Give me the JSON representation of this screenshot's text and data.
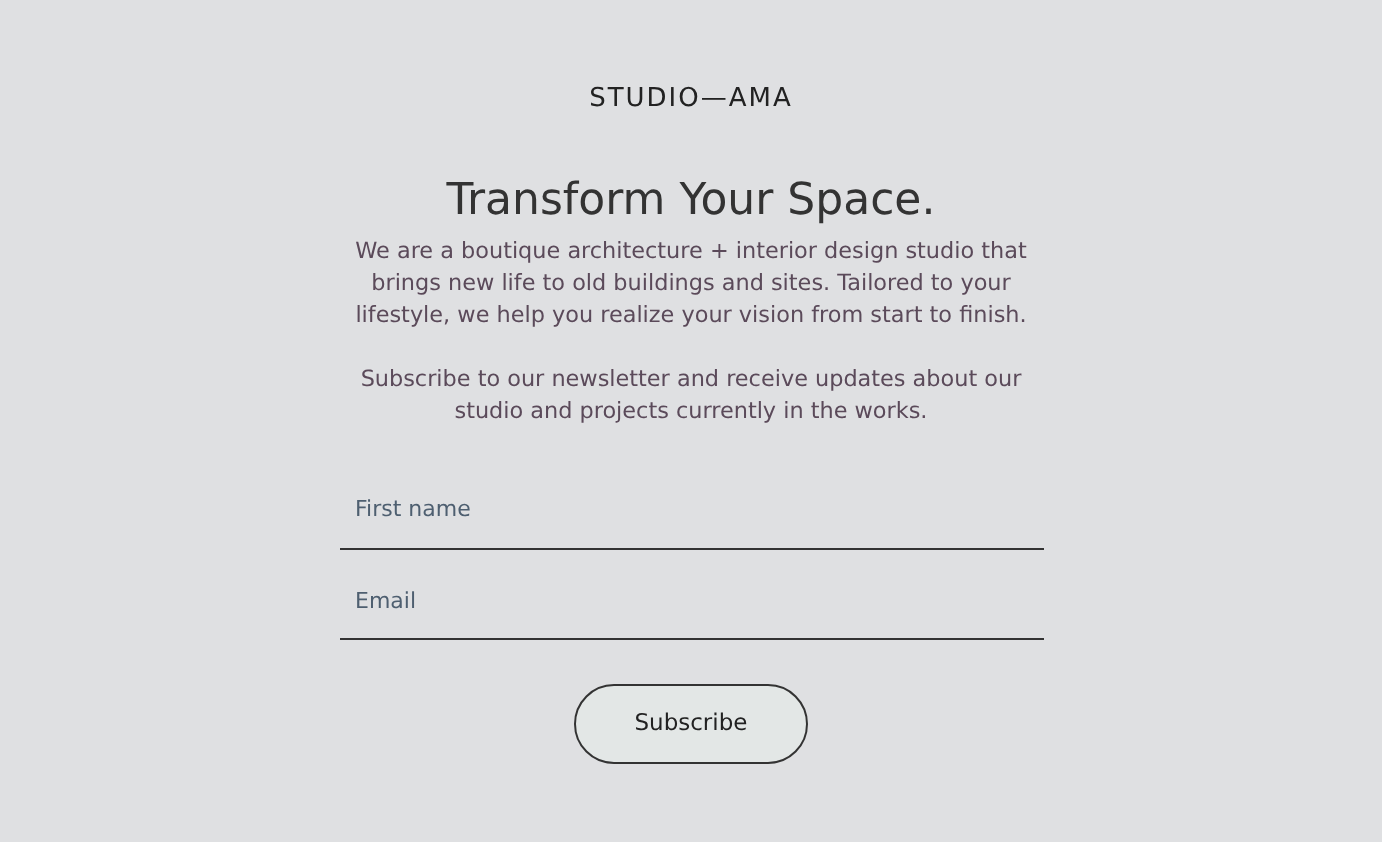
{
  "logo": "STUDIO—AMA",
  "heading": "Transform Your Space.",
  "paragraphs": [
    "We are a boutique architecture + interior design studio that brings new life to old buildings and sites. Tailored to your lifestyle, we help you realize your vision from start to finish.",
    "Subscribe to our newsletter and receive updates about our studio and projects currently in the works."
  ],
  "form": {
    "fields": [
      {
        "placeholder": "First name"
      },
      {
        "placeholder": "Email"
      }
    ],
    "button": "Subscribe"
  }
}
